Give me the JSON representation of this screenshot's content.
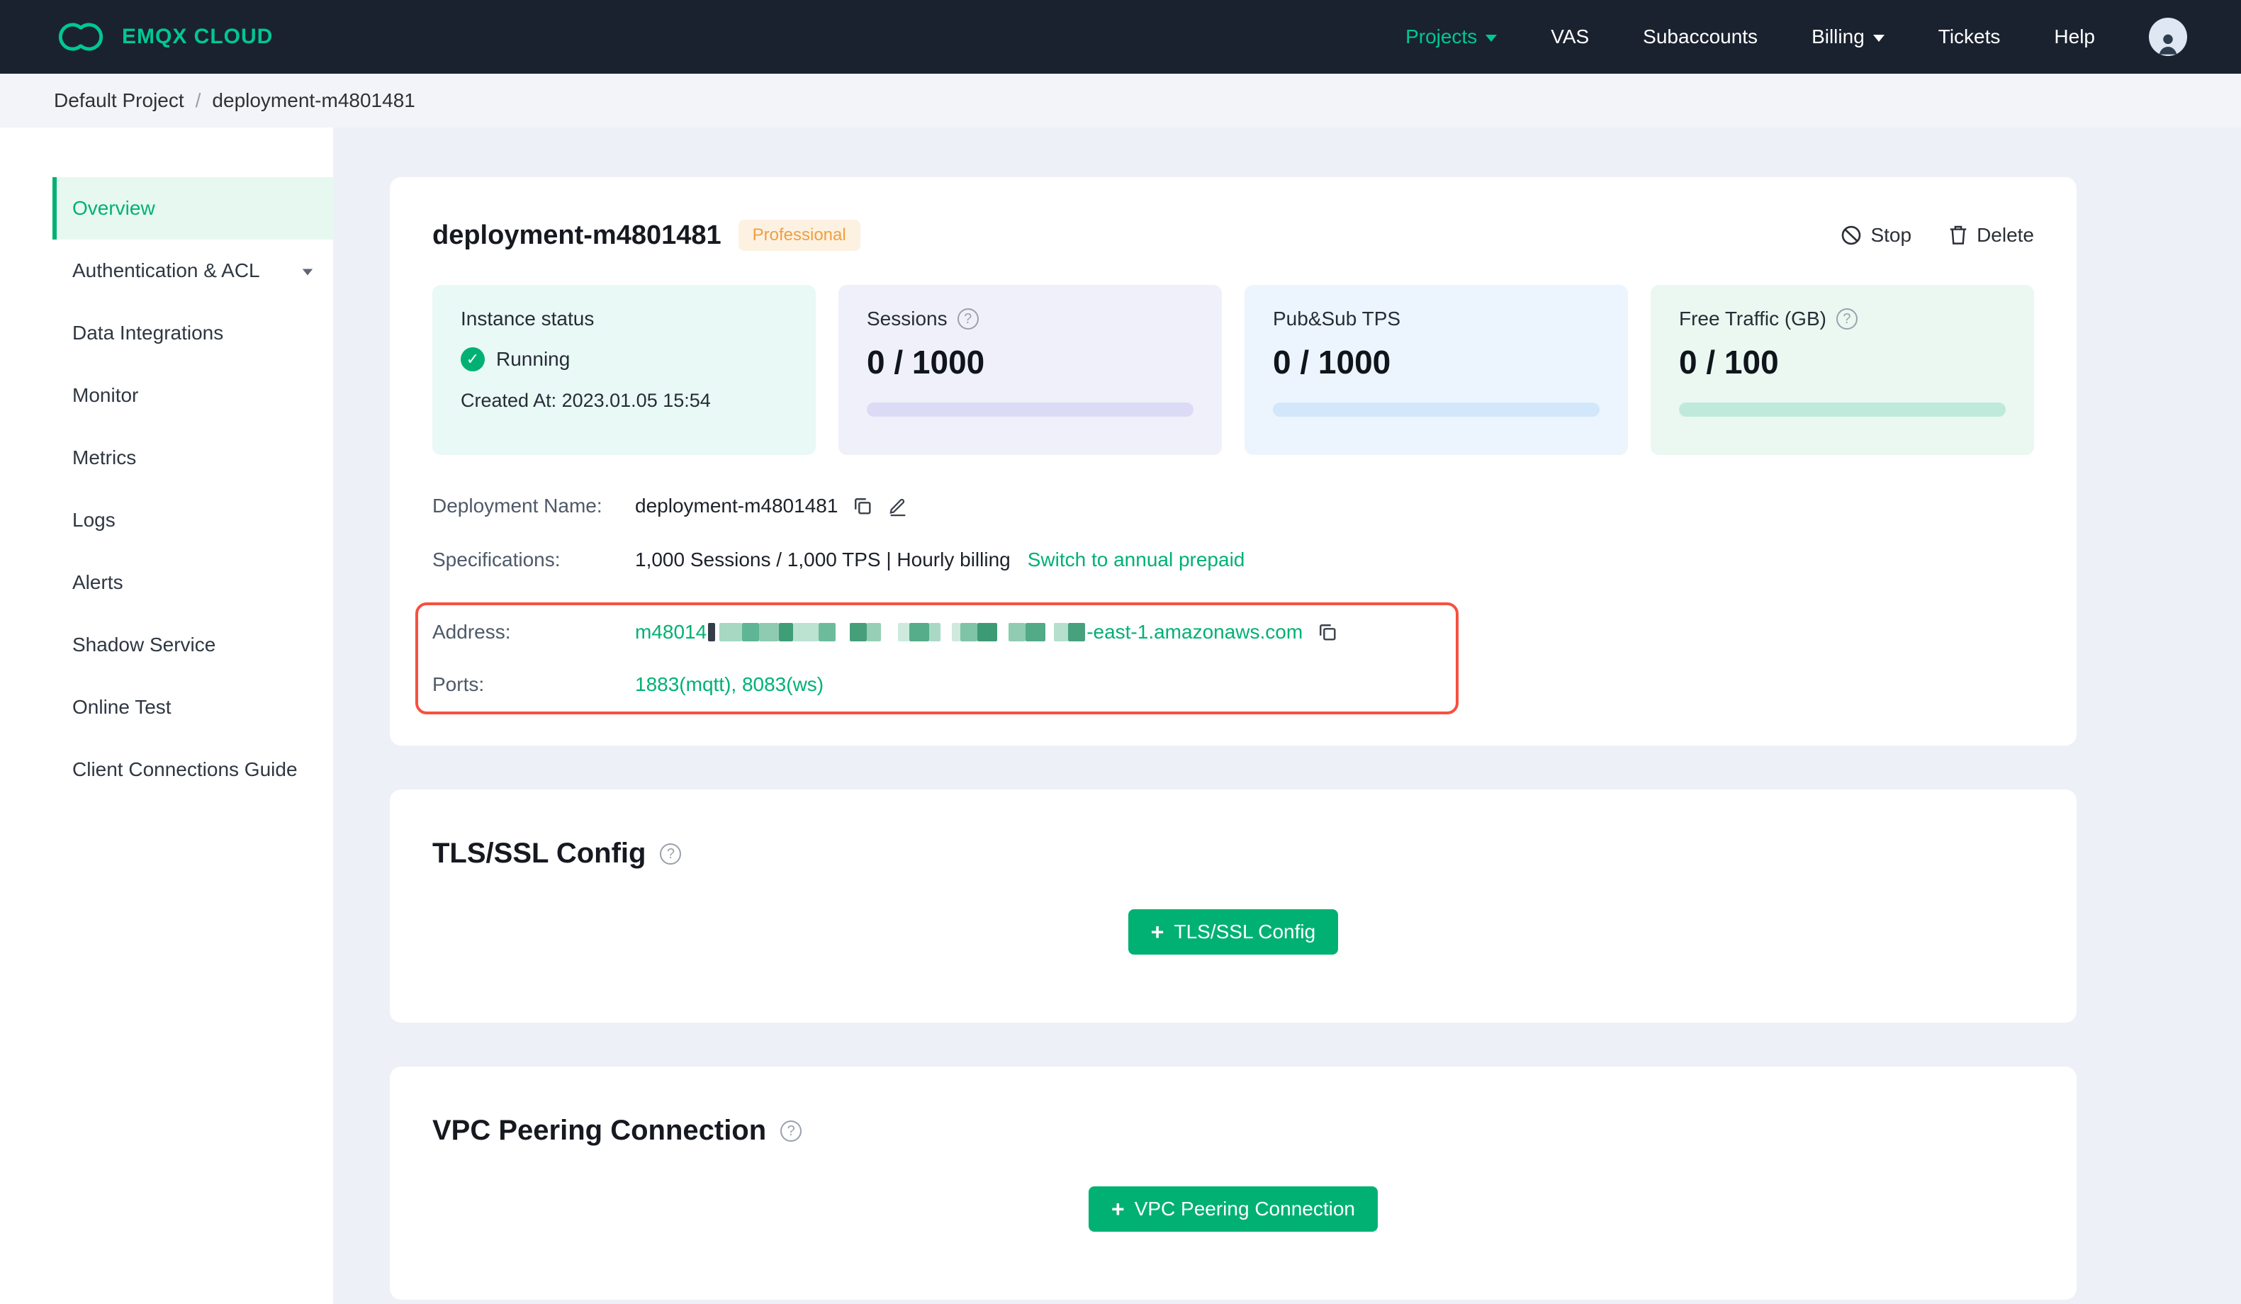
{
  "colors": {
    "brand_green": "#00c795",
    "accent_green": "#00b173",
    "highlight_red": "#f7503f",
    "badge_bg": "#fdf1e1",
    "badge_text": "#ef9f42",
    "navbar_bg": "#1a2230"
  },
  "navbar": {
    "logo_text": "EMQX CLOUD",
    "items": [
      {
        "label": "Projects"
      },
      {
        "label": "VAS"
      },
      {
        "label": "Subaccounts"
      },
      {
        "label": "Billing"
      },
      {
        "label": "Tickets"
      },
      {
        "label": "Help"
      }
    ]
  },
  "breadcrumb": {
    "project": "Default Project",
    "separator": "/",
    "current": "deployment-m4801481"
  },
  "sidebar": {
    "items": [
      {
        "label": "Overview"
      },
      {
        "label": "Authentication & ACL"
      },
      {
        "label": "Data Integrations"
      },
      {
        "label": "Monitor"
      },
      {
        "label": "Metrics"
      },
      {
        "label": "Logs"
      },
      {
        "label": "Alerts"
      },
      {
        "label": "Shadow Service"
      },
      {
        "label": "Online Test"
      },
      {
        "label": "Client Connections Guide"
      }
    ]
  },
  "deployment": {
    "title": "deployment-m4801481",
    "badge": "Professional",
    "stop_label": "Stop",
    "delete_label": "Delete",
    "stats": {
      "instance": {
        "title": "Instance status",
        "status": "Running",
        "created": "Created At: 2023.01.05 15:54"
      },
      "sessions": {
        "title": "Sessions",
        "value": "0 / 1000"
      },
      "tps": {
        "title": "Pub&Sub TPS",
        "value": "0 / 1000"
      },
      "traffic": {
        "title": "Free Traffic (GB)",
        "value": "0 / 100"
      }
    },
    "details": {
      "deployment_name_label": "Deployment Name:",
      "deployment_name_value": "deployment-m4801481",
      "specifications_label": "Specifications:",
      "specifications_value": "1,000 Sessions / 1,000 TPS | Hourly billing",
      "specifications_link": "Switch to annual prepaid",
      "address_label": "Address:",
      "address_prefix": "m48014",
      "address_suffix": "-east-1.amazonaws.com",
      "ports_label": "Ports:",
      "ports_value": "1883(mqtt), 8083(ws)"
    }
  },
  "tls": {
    "title": "TLS/SSL Config",
    "button": "TLS/SSL Config"
  },
  "vpc": {
    "title": "VPC Peering Connection",
    "button": "VPC Peering Connection"
  },
  "icons": {
    "question": "?",
    "check": "✓",
    "plus": "+"
  },
  "address_redaction": [
    {
      "w": 5,
      "c": "#333e49",
      "g": 3
    },
    {
      "w": 16,
      "c": "#a6d8c2",
      "g": 0
    },
    {
      "w": 12,
      "c": "#5fb694",
      "g": 0
    },
    {
      "w": 14,
      "c": "#8fcbb0",
      "g": 0
    },
    {
      "w": 10,
      "c": "#3f9e78",
      "g": 0
    },
    {
      "w": 18,
      "c": "#bce2d1",
      "g": 0
    },
    {
      "w": 12,
      "c": "#6cbc9b",
      "g": 10
    },
    {
      "w": 12,
      "c": "#459f7b",
      "g": 0
    },
    {
      "w": 10,
      "c": "#96cfb6",
      "g": 12
    },
    {
      "w": 8,
      "c": "#cdeadd",
      "g": 0
    },
    {
      "w": 14,
      "c": "#55ad8a",
      "g": 0
    },
    {
      "w": 8,
      "c": "#a9d9c4",
      "g": 8
    },
    {
      "w": 6,
      "c": "#cfe9dd",
      "g": 0
    },
    {
      "w": 12,
      "c": "#7fc4a6",
      "g": 0
    },
    {
      "w": 14,
      "c": "#3c9b75",
      "g": 8
    },
    {
      "w": 12,
      "c": "#90ccb2",
      "g": 0
    },
    {
      "w": 14,
      "c": "#52aa87",
      "g": 6
    },
    {
      "w": 10,
      "c": "#b7dfcd",
      "g": 0
    },
    {
      "w": 12,
      "c": "#47a17d",
      "g": 0
    }
  ]
}
